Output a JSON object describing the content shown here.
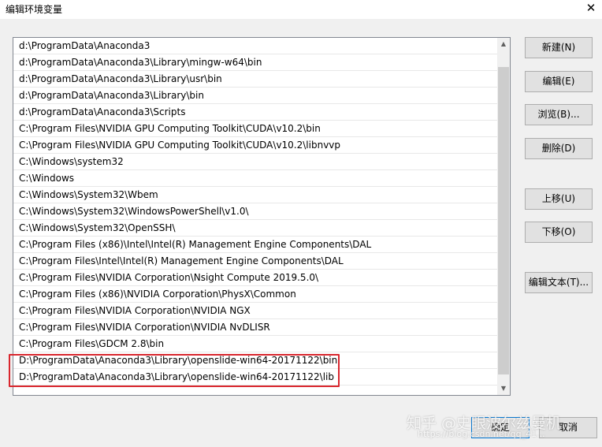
{
  "window": {
    "title": "编辑环境变量",
    "close_glyph": "✕"
  },
  "entries": [
    "d:\\ProgramData\\Anaconda3",
    "d:\\ProgramData\\Anaconda3\\Library\\mingw-w64\\bin",
    "d:\\ProgramData\\Anaconda3\\Library\\usr\\bin",
    "d:\\ProgramData\\Anaconda3\\Library\\bin",
    "d:\\ProgramData\\Anaconda3\\Scripts",
    "C:\\Program Files\\NVIDIA GPU Computing Toolkit\\CUDA\\v10.2\\bin",
    "C:\\Program Files\\NVIDIA GPU Computing Toolkit\\CUDA\\v10.2\\libnvvp",
    "C:\\Windows\\system32",
    "C:\\Windows",
    "C:\\Windows\\System32\\Wbem",
    "C:\\Windows\\System32\\WindowsPowerShell\\v1.0\\",
    "C:\\Windows\\System32\\OpenSSH\\",
    "C:\\Program Files (x86)\\Intel\\Intel(R) Management Engine Components\\DAL",
    "C:\\Program Files\\Intel\\Intel(R) Management Engine Components\\DAL",
    "C:\\Program Files\\NVIDIA Corporation\\Nsight Compute 2019.5.0\\",
    "C:\\Program Files (x86)\\NVIDIA Corporation\\PhysX\\Common",
    "C:\\Program Files\\NVIDIA Corporation\\NVIDIA NGX",
    "C:\\Program Files\\NVIDIA Corporation\\NVIDIA NvDLISR",
    "C:\\Program Files\\GDCM 2.8\\bin",
    "D:\\ProgramData\\Anaconda3\\Library\\openslide-win64-20171122\\bin",
    "D:\\ProgramData\\Anaconda3\\Library\\openslide-win64-20171122\\lib"
  ],
  "buttons": {
    "new": "新建(N)",
    "edit": "编辑(E)",
    "browse": "浏览(B)...",
    "delete": "删除(D)",
    "move_up": "上移(U)",
    "move_down": "下移(O)",
    "edit_text": "编辑文本(T)...",
    "ok": "确定",
    "cancel": "取消"
  },
  "scrollbar": {
    "up_glyph": "▲",
    "down_glyph": "▼"
  },
  "watermark": {
    "line1": "知乎 @史眼波尔兹曼机",
    "line2": "https://blog.csdn.net/qq_41..."
  },
  "colors": {
    "highlight_border": "#d9272e",
    "default_button_border": "#0078d7"
  }
}
